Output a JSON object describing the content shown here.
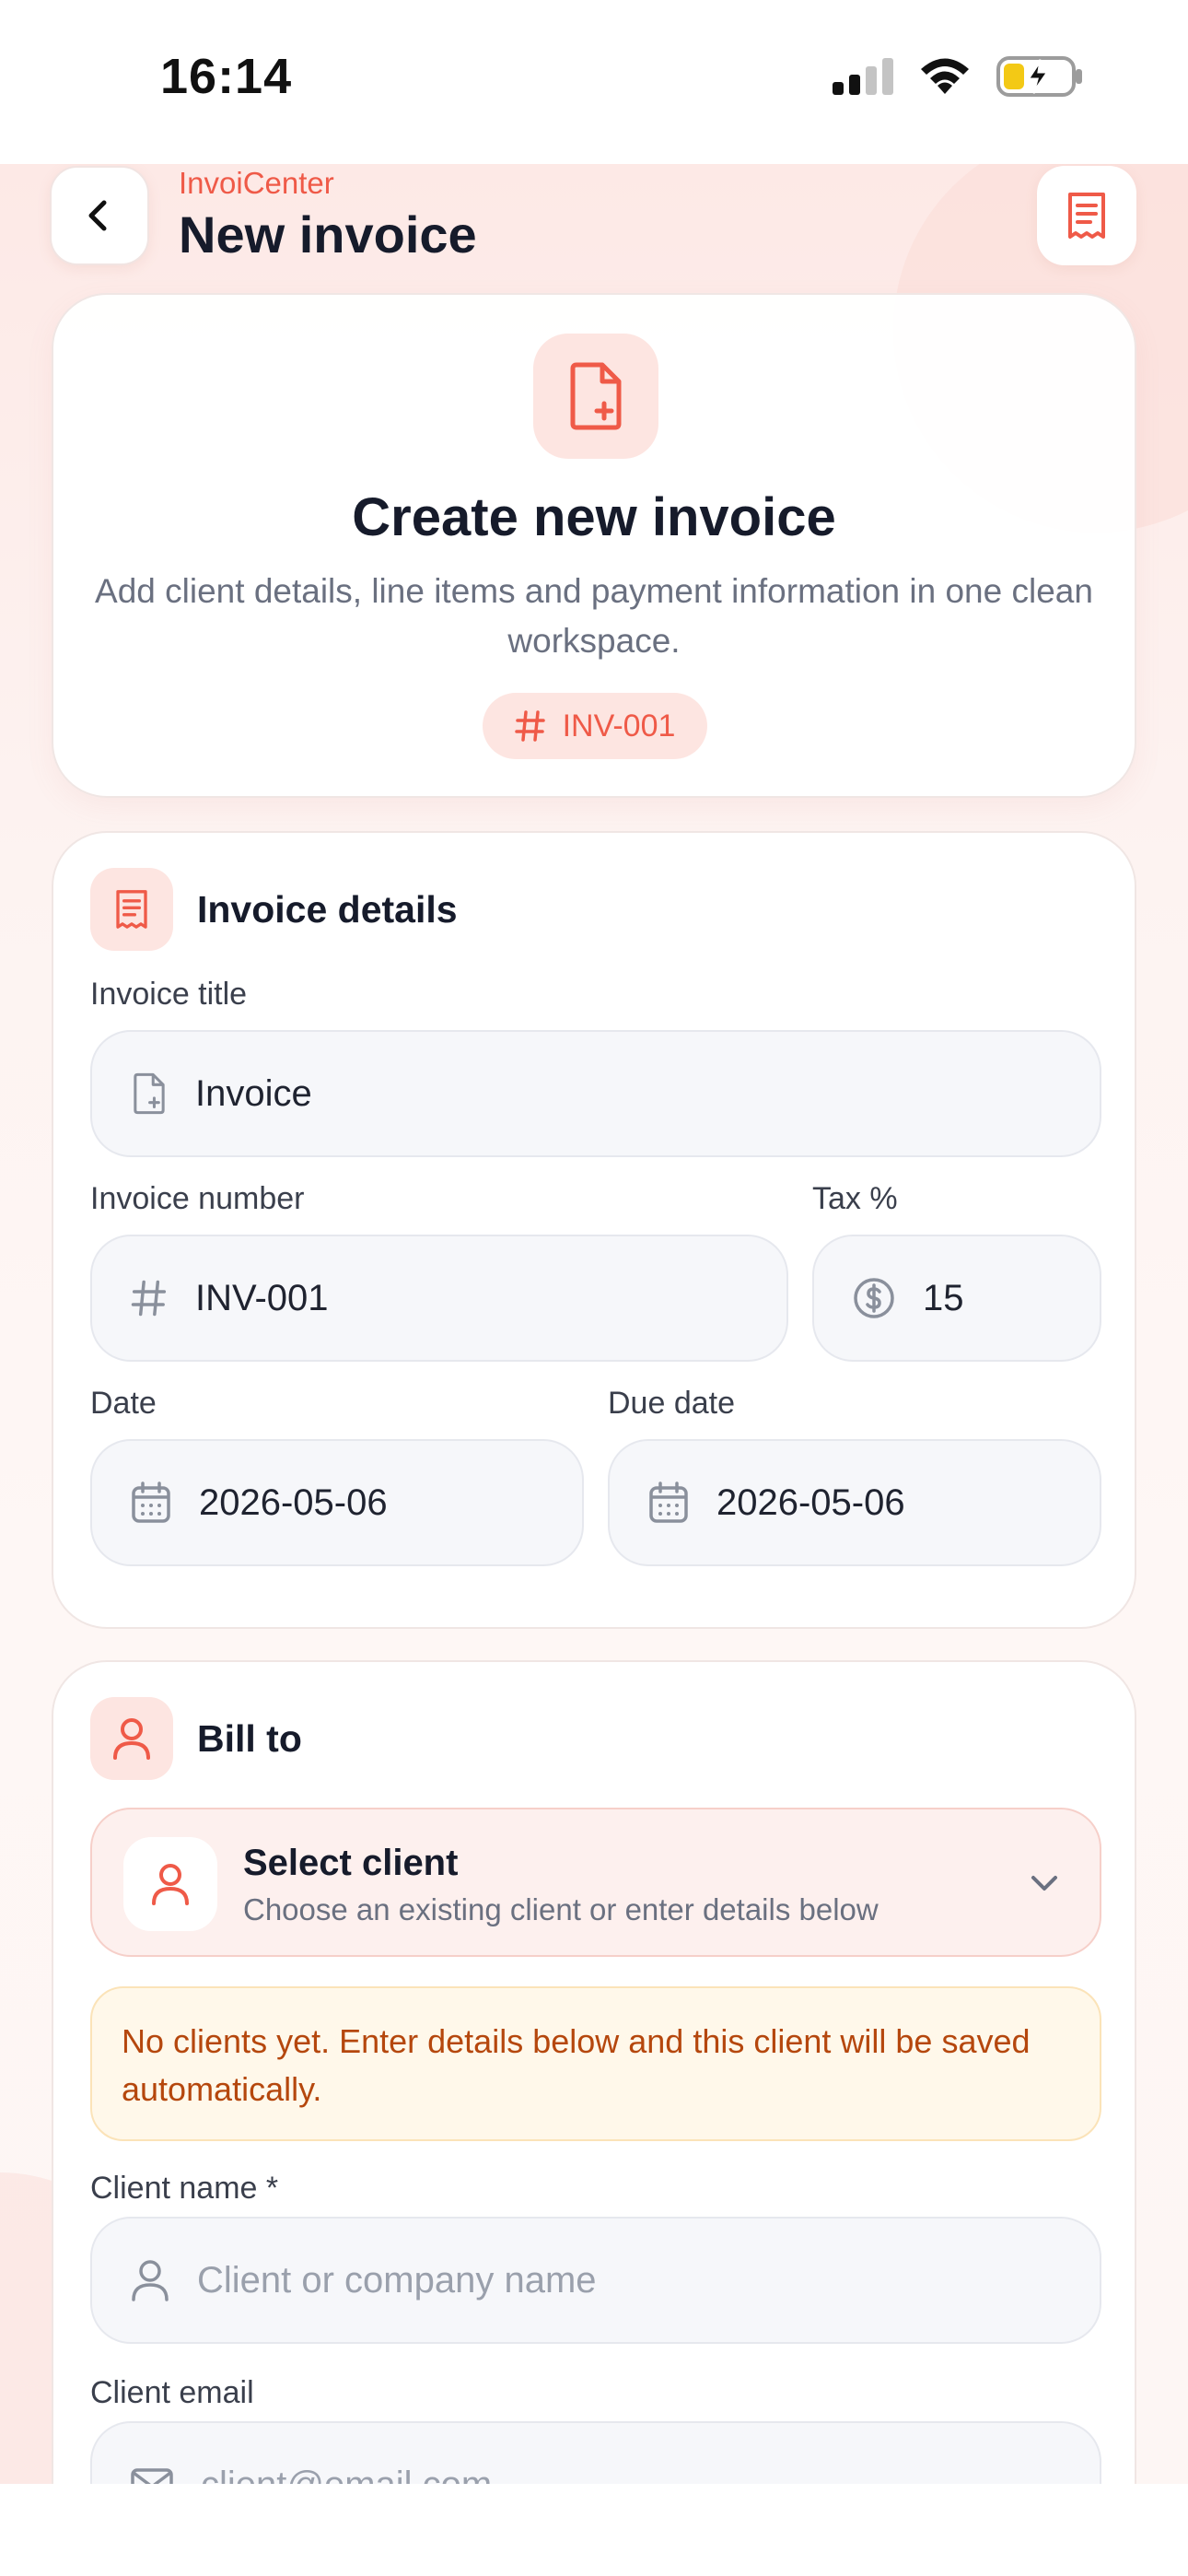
{
  "status": {
    "time": "16:14"
  },
  "header": {
    "brand": "InvoiCenter",
    "title": "New invoice"
  },
  "hero": {
    "title": "Create new invoice",
    "subtitle": "Add client details, line items and payment information in one clean workspace.",
    "badge": "INV-001"
  },
  "details": {
    "section_title": "Invoice details",
    "invoice_title_label": "Invoice title",
    "invoice_title_value": "Invoice",
    "invoice_number_label": "Invoice number",
    "invoice_number_value": "INV-001",
    "tax_label": "Tax %",
    "tax_value": "15",
    "date_label": "Date",
    "date_value": "2026-05-06",
    "due_date_label": "Due date",
    "due_date_value": "2026-05-06"
  },
  "bill_to": {
    "section_title": "Bill to",
    "select_title": "Select client",
    "select_subtitle": "Choose an existing client or enter details below",
    "notice": "No clients yet. Enter details below and this client will be saved automatically.",
    "client_name_label": "Client name *",
    "client_name_placeholder": "Client or company name",
    "client_email_label": "Client email",
    "client_email_placeholder": "client@email.com"
  },
  "colors": {
    "accent": "#ef5a48",
    "accent_soft": "#fde5e1",
    "notice_text": "#b5470d"
  }
}
